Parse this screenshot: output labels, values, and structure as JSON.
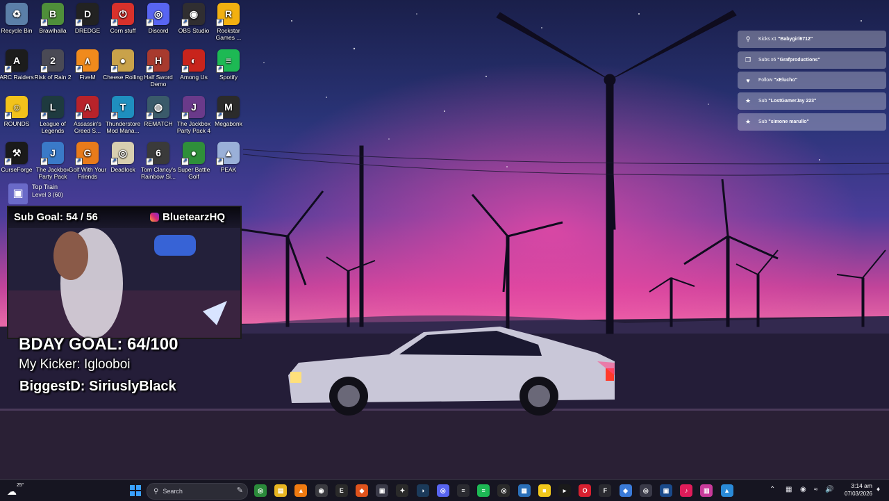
{
  "desktop": {
    "icons": [
      {
        "label": "Recycle Bin",
        "glyph": "♻",
        "color": "#5b7fa8",
        "name": "recycle-bin-icon"
      },
      {
        "label": "Brawlhalla",
        "glyph": "B",
        "color": "#4f8f3a",
        "name": "brawlhalla-icon"
      },
      {
        "label": "DREDGE",
        "glyph": "D",
        "color": "#222222",
        "name": "dredge-icon"
      },
      {
        "label": "Corn stuff",
        "glyph": "⏻",
        "color": "#d8312b",
        "name": "corn-stuff-icon"
      },
      {
        "label": "Discord",
        "glyph": "◎",
        "color": "#5865f2",
        "name": "discord-icon"
      },
      {
        "label": "OBS Studio",
        "glyph": "◉",
        "color": "#302e31",
        "name": "obs-studio-icon"
      },
      {
        "label": "Rockstar Games ...",
        "glyph": "R",
        "color": "#f2b010",
        "name": "rockstar-games-icon"
      },
      {
        "label": "ARC Raiders",
        "glyph": "A",
        "color": "#1c1c1c",
        "name": "arc-raiders-icon"
      },
      {
        "label": "Risk of Rain 2",
        "glyph": "2",
        "color": "#4a4a55",
        "name": "risk-of-rain-icon"
      },
      {
        "label": "FiveM",
        "glyph": "∧",
        "color": "#f08a1c",
        "name": "fivem-icon"
      },
      {
        "label": "Cheese Rolling",
        "glyph": "●",
        "color": "#c9a24a",
        "name": "cheese-rolling-icon"
      },
      {
        "label": "Half Sword Demo",
        "glyph": "H",
        "color": "#a83a2e",
        "name": "half-sword-icon"
      },
      {
        "label": "Among Us",
        "glyph": "◐",
        "color": "#c8241c",
        "name": "among-us-icon"
      },
      {
        "label": "Spotify",
        "glyph": "≡",
        "color": "#1db954",
        "name": "spotify-icon"
      },
      {
        "label": "ROUNDS",
        "glyph": "☺",
        "color": "#f2c21b",
        "name": "rounds-icon"
      },
      {
        "label": "League of Legends",
        "glyph": "L",
        "color": "#1e3a3f",
        "name": "league-of-legends-icon"
      },
      {
        "label": "Assassin's Creed S...",
        "glyph": "A",
        "color": "#b8232a",
        "name": "assassins-creed-icon"
      },
      {
        "label": "Thunderstore Mod Mana...",
        "glyph": "T",
        "color": "#1f8fbf",
        "name": "thunderstore-icon"
      },
      {
        "label": "REMATCH",
        "glyph": "◍",
        "color": "#3a5a6a",
        "name": "rematch-icon"
      },
      {
        "label": "The Jackbox Party Pack 4",
        "glyph": "J",
        "color": "#6a3a8a",
        "name": "jackbox-4-icon"
      },
      {
        "label": "Megabonk",
        "glyph": "M",
        "color": "#2b2b2b",
        "name": "megabonk-icon"
      },
      {
        "label": "CurseForge",
        "glyph": "⚒",
        "color": "#1a1a1a",
        "name": "curseforge-icon"
      },
      {
        "label": "The Jackbox Party Pack",
        "glyph": "J",
        "color": "#3a7ac8",
        "name": "jackbox-icon"
      },
      {
        "label": "Golf With Your Friends",
        "glyph": "G",
        "color": "#e87b1a",
        "name": "golf-with-friends-icon"
      },
      {
        "label": "Deadlock",
        "glyph": "◎",
        "color": "#d8cfb0",
        "name": "deadlock-icon"
      },
      {
        "label": "Tom Clancy's Rainbow Si...",
        "glyph": "6",
        "color": "#3a3a3a",
        "name": "rainbow-six-icon"
      },
      {
        "label": "Super Battle Golf",
        "glyph": "●",
        "color": "#2f8f3a",
        "name": "super-battle-golf-icon"
      },
      {
        "label": "PEAK",
        "glyph": "▲",
        "color": "#9ab0d8",
        "name": "peak-icon"
      }
    ]
  },
  "notifications": [
    {
      "icon": "⚲",
      "icon_name": "kick-icon",
      "prefix": "Kicks x1",
      "user": "\"Babygirl6712\""
    },
    {
      "icon": "❒",
      "icon_name": "gift-icon",
      "prefix": "Subs x6",
      "user": "\"Grafproductions\""
    },
    {
      "icon": "♥",
      "icon_name": "heart-icon",
      "prefix": "Follow",
      "user": "\"xElucho\""
    },
    {
      "icon": "★",
      "icon_name": "star-icon",
      "prefix": "Sub",
      "user": "\"LostGamerJay 223\""
    },
    {
      "icon": "★",
      "icon_name": "star-icon",
      "prefix": "Sub",
      "user": "\"simone marullo\""
    }
  ],
  "overlay": {
    "top_train_title": "Top Train",
    "top_train_level": "Level 3  (60)",
    "sub_goal": "Sub Goal:  54 / 56",
    "channel": "BluetearzHQ",
    "bday_goal": "BDAY GOAL: 64/100",
    "kicker": "My Kicker: Iglooboi",
    "biggest": "BiggestD: SiriuslyBlack"
  },
  "taskbar": {
    "weather": "25°",
    "search_placeholder": "Search",
    "time": "3:14 am",
    "date": "07/03/2026",
    "apps": [
      {
        "name": "chrome-icon",
        "glyph": "◎",
        "color": "#2a8a3a"
      },
      {
        "name": "file-explorer-icon",
        "glyph": "▤",
        "color": "#e8b521"
      },
      {
        "name": "vlc-icon",
        "glyph": "▲",
        "color": "#f07a10"
      },
      {
        "name": "obs-icon",
        "glyph": "◉",
        "color": "#3a3a40"
      },
      {
        "name": "epic-games-icon",
        "glyph": "E",
        "color": "#2a2a2a"
      },
      {
        "name": "brave-icon",
        "glyph": "◆",
        "color": "#e0531c"
      },
      {
        "name": "notes-app-icon",
        "glyph": "▣",
        "color": "#3a3a48"
      },
      {
        "name": "capcut-icon",
        "glyph": "✦",
        "color": "#2a2a2a"
      },
      {
        "name": "steam-icon",
        "glyph": "◑",
        "color": "#1b3a5a"
      },
      {
        "name": "discord-icon",
        "glyph": "◎",
        "color": "#5865f2"
      },
      {
        "name": "capture-app-icon",
        "glyph": "≡",
        "color": "#2a2a30"
      },
      {
        "name": "spotify-icon",
        "glyph": "≡",
        "color": "#1db954"
      },
      {
        "name": "xbox-icon",
        "glyph": "◎",
        "color": "#2a2a2a"
      },
      {
        "name": "photos-icon",
        "glyph": "▦",
        "color": "#2a6fb8"
      },
      {
        "name": "sticky-notes-icon",
        "glyph": "■",
        "color": "#f2c81b"
      },
      {
        "name": "terminal-icon",
        "glyph": "▸",
        "color": "#1a1a1a"
      },
      {
        "name": "opera-icon",
        "glyph": "O",
        "color": "#d82030"
      },
      {
        "name": "f-app-icon",
        "glyph": "F",
        "color": "#2a2a30"
      },
      {
        "name": "diamond-app-icon",
        "glyph": "◆",
        "color": "#3a7ad8"
      },
      {
        "name": "circle-app-icon",
        "glyph": "◎",
        "color": "#3a3a48"
      },
      {
        "name": "media-app-icon",
        "glyph": "▣",
        "color": "#1a4a8a"
      },
      {
        "name": "tiktok-icon",
        "glyph": "♪",
        "color": "#e01c5a"
      },
      {
        "name": "phone-link-icon",
        "glyph": "▥",
        "color": "#c83a9a"
      },
      {
        "name": "blue-app-icon",
        "glyph": "▲",
        "color": "#2a8ad8"
      }
    ]
  }
}
